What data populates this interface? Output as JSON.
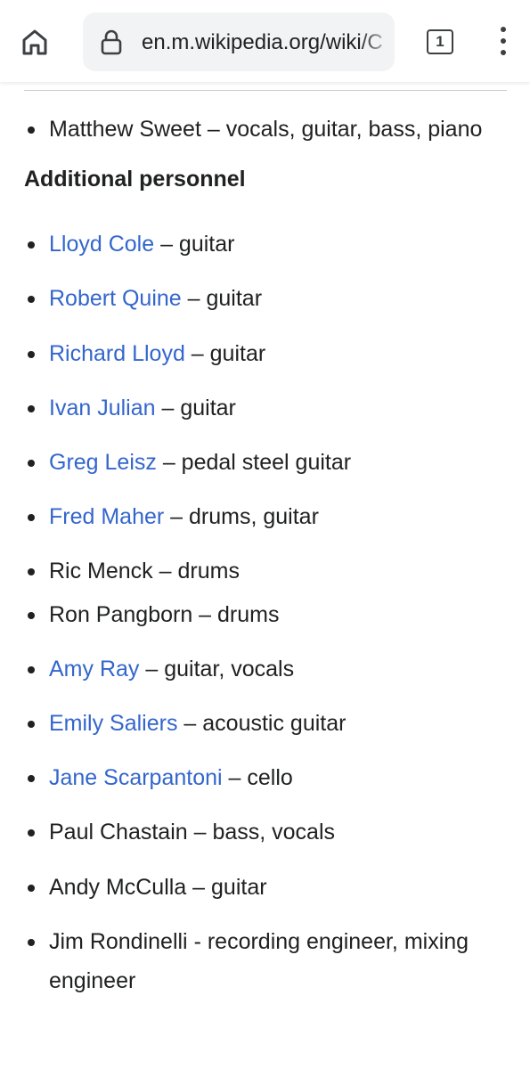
{
  "browser": {
    "url": "en.m.wikipedia.org/wiki/C",
    "tab_count": "1"
  },
  "top_item": {
    "text": "Matthew Sweet – vocals, guitar, bass, piano"
  },
  "heading": "Additional personnel",
  "personnel": [
    {
      "name": "Lloyd Cole",
      "role": " – guitar",
      "linked": true
    },
    {
      "name": "Robert Quine",
      "role": " – guitar",
      "linked": true
    },
    {
      "name": "Richard Lloyd",
      "role": " – guitar",
      "linked": true
    },
    {
      "name": "Ivan Julian",
      "role": " – guitar",
      "linked": true
    },
    {
      "name": "Greg Leisz",
      "role": " – pedal steel guitar",
      "linked": true
    },
    {
      "name": "Fred Maher",
      "role": " – drums, guitar",
      "linked": true
    },
    {
      "name": "Ric Menck",
      "role": " – drums",
      "linked": false
    },
    {
      "name": "Ron Pangborn",
      "role": " – drums",
      "linked": false
    },
    {
      "name": "Amy Ray",
      "role": " – guitar, vocals",
      "linked": true
    },
    {
      "name": "Emily Saliers",
      "role": " – acoustic guitar",
      "linked": true
    },
    {
      "name": "Jane Scarpantoni",
      "role": " – cello",
      "linked": true
    },
    {
      "name": "Paul Chastain",
      "role": " – bass, vocals",
      "linked": false
    },
    {
      "name": "Andy McCulla",
      "role": " – guitar",
      "linked": false
    },
    {
      "name": "Jim Rondinelli",
      "role": " - recording engineer, mixing engineer",
      "linked": false
    }
  ],
  "colors": {
    "link": "#3366cc",
    "text": "#202122"
  }
}
